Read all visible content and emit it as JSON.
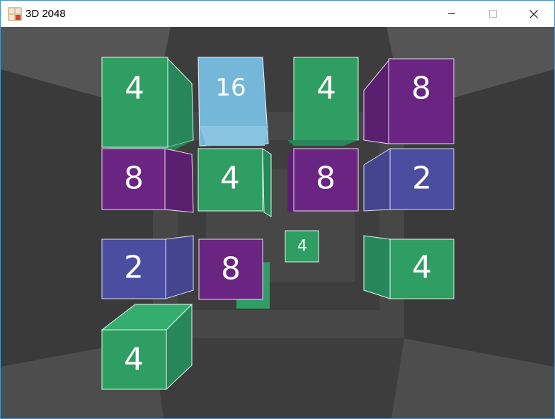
{
  "window": {
    "title": "3D 2048",
    "app_icon": "game-app-icon",
    "controls": {
      "minimize": "minimize-icon",
      "maximize": "maximize-icon",
      "close": "close-icon"
    }
  },
  "colors": {
    "tile_2": "#4b4ea0",
    "tile_4": "#2e9e62",
    "tile_8": "#6a2482",
    "tile_16": "#74b7d8",
    "background": "#3b3b3b"
  },
  "board": {
    "tiles": [
      {
        "id": "tile-4-top-left",
        "value": "4"
      },
      {
        "id": "tile-16-top",
        "value": "16"
      },
      {
        "id": "tile-4-top-right",
        "value": "4"
      },
      {
        "id": "tile-8-top-far-right",
        "value": "8"
      },
      {
        "id": "tile-8-middle-left",
        "value": "8"
      },
      {
        "id": "tile-4-middle",
        "value": "4"
      },
      {
        "id": "tile-8-middle-right",
        "value": "8"
      },
      {
        "id": "tile-2-middle-far-right",
        "value": "2"
      },
      {
        "id": "tile-2-lower-left",
        "value": "2"
      },
      {
        "id": "tile-8-lower-middle",
        "value": "8"
      },
      {
        "id": "tile-4-small-back",
        "value": "4"
      },
      {
        "id": "tile-4-lower-right",
        "value": "4"
      },
      {
        "id": "tile-4-bottom-left",
        "value": "4"
      }
    ]
  }
}
